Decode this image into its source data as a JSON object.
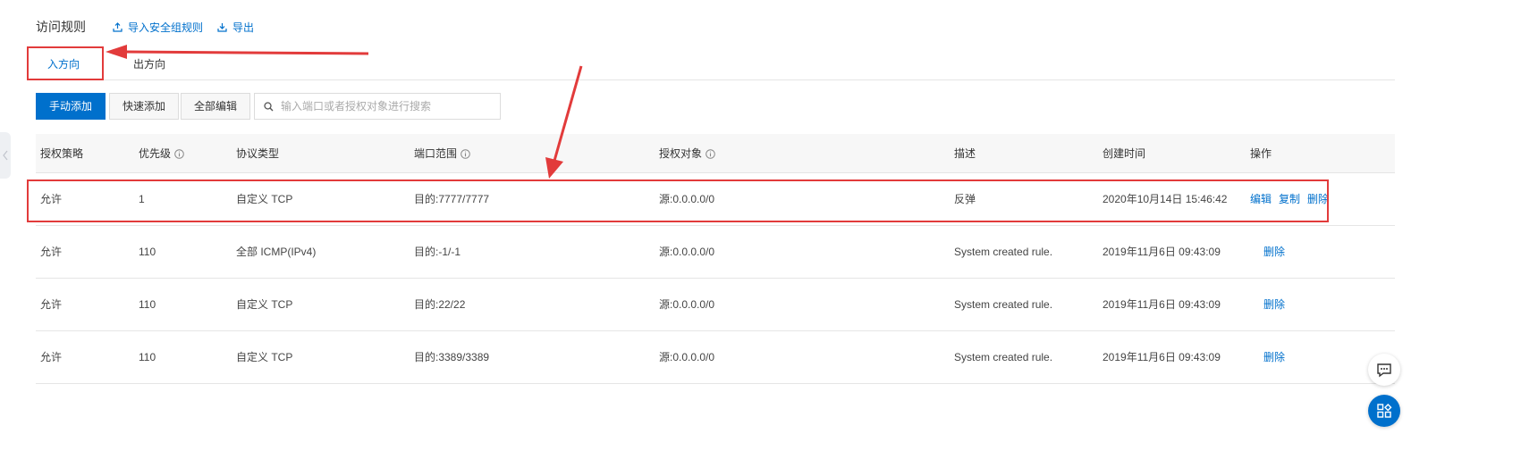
{
  "header": {
    "title": "访问规则",
    "import_label": "导入安全组规则",
    "export_label": "导出"
  },
  "tabs": [
    {
      "label": "入方向",
      "active": true
    },
    {
      "label": "出方向",
      "active": false
    }
  ],
  "toolbar": {
    "manual_add": "手动添加",
    "quick_add": "快速添加",
    "edit_all": "全部编辑",
    "search_placeholder": "输入端口或者授权对象进行搜索"
  },
  "table": {
    "columns": [
      "授权策略",
      "优先级",
      "协议类型",
      "端口范围",
      "授权对象",
      "描述",
      "创建时间",
      "操作"
    ],
    "rows": [
      {
        "policy": "允许",
        "priority": "1",
        "protocol": "自定义 TCP",
        "port": "目的:7777/7777",
        "object": "源:0.0.0.0/0",
        "desc": "反弹",
        "time": "2020年10月14日 15:46:42",
        "ops": [
          "编辑",
          "复制",
          "删除"
        ]
      },
      {
        "policy": "允许",
        "priority": "110",
        "protocol": "全部 ICMP(IPv4)",
        "port": "目的:-1/-1",
        "object": "源:0.0.0.0/0",
        "desc": "System created rule.",
        "time": "2019年11月6日 09:43:09",
        "ops": [
          "删除"
        ]
      },
      {
        "policy": "允许",
        "priority": "110",
        "protocol": "自定义 TCP",
        "port": "目的:22/22",
        "object": "源:0.0.0.0/0",
        "desc": "System created rule.",
        "time": "2019年11月6日 09:43:09",
        "ops": [
          "删除"
        ]
      },
      {
        "policy": "允许",
        "priority": "110",
        "protocol": "自定义 TCP",
        "port": "目的:3389/3389",
        "object": "源:0.0.0.0/0",
        "desc": "System created rule.",
        "time": "2019年11月6日 09:43:09",
        "ops": [
          "删除"
        ]
      }
    ]
  },
  "icons": {
    "import": "upload-icon",
    "export": "download-icon",
    "search": "search-icon",
    "info": "info-circle-icon",
    "feedback": "chat-icon",
    "apps": "apps-icon"
  },
  "colors": {
    "accent": "#0070cc",
    "annotation": "#e23b3b"
  }
}
